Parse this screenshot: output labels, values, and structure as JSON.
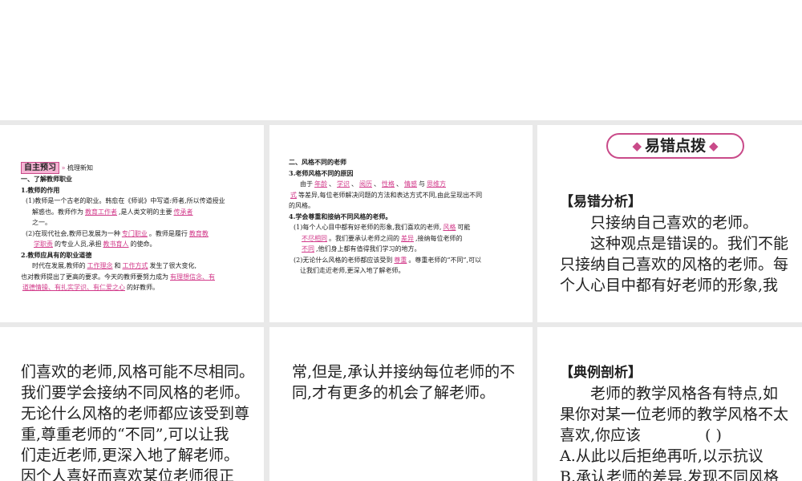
{
  "p1": {
    "header_box": "自主预习",
    "header_arrow": "»",
    "header_sub": "梳理新知",
    "s1_title": "一、了解教师职业",
    "q1": "1.教师的作用",
    "q1_1a": "(1)教师是一个古老的职业。韩愈在《师说》中写道:师者,所以传道授业",
    "q1_1b_pre": "解惑也。教师作为",
    "q1_1b_ans1": "教育工作者",
    "q1_1b_mid": ",是人类文明的主要",
    "q1_1b_ans2": "传承者",
    "q1_1c": "之一。",
    "q1_2a_pre": "(2)在现代社会,教师已发展为一种",
    "q1_2a_ans1": "专门职业",
    "q1_2a_mid": "。教师是履行",
    "q1_2a_ans2": "教育教",
    "q1_2b_ans2b": "学职责",
    "q1_2b_mid": "的专业人员,承担",
    "q1_2b_ans3": "教书育人",
    "q1_2b_post": "的使命。",
    "q2": "2.教师应具有的职业道德",
    "q2a_pre": "时代在发展,教师的",
    "q2a_ans1": "工作理念",
    "q2a_mid": "和",
    "q2a_ans2": "工作方式",
    "q2a_post": "发生了很大变化,",
    "q2b_pre": "也对教师提出了更高的要求。今天的教师要努力成为",
    "q2b_ans": "有理想信念、有",
    "q2c_ans": "道德情操、有扎实学识、有仁爱之心",
    "q2c_post": "的好教师。"
  },
  "p2": {
    "s2_title": "二、风格不同的老师",
    "q3": "3.老师风格不同的原因",
    "q3a_pre": "由于",
    "q3a_ans1": "年龄",
    "q3a_ans2": "学识",
    "q3a_ans3": "阅历",
    "q3a_ans4": "性格",
    "q3a_ans5": "情感",
    "q3a_and": "与",
    "q3a_ans6": "思维方",
    "q3b_ans6b": "式",
    "q3b_post": "等差异,每位老师解决问题的方法和表达方式不同,由此呈现出不同",
    "q3c": "的风格。",
    "q4": "4.学会尊重和接纳不同风格的老师。",
    "q4_1a_pre": "(1)每个人心目中都有好老师的形象,我们喜欢的老师,",
    "q4_1a_ans": "风格",
    "q4_1a_post": "可能",
    "q4_1b_ans": "不尽相同",
    "q4_1b_mid": "。我们要承认老师之间的",
    "q4_1b_ans2": "差异",
    "q4_1b_post": ",接纳每位老师的",
    "q4_1c_ans": "不同",
    "q4_1c_post": ",他们身上都有值得我们学习的地方。",
    "q4_2a_pre": "(2)无论什么风格的老师都应该受到",
    "q4_2a_ans": "尊重",
    "q4_2a_post": "。尊重老师的“不同”,可以",
    "q4_2b": "让我们走近老师,更深入地了解老师。"
  },
  "p3": {
    "banner_left": "◆",
    "banner": "易错点拨",
    "banner_right": "◆",
    "label": "【易错分析】",
    "l1": "只接纳自己喜欢的老师。",
    "l2": "这种观点是错误的。我们不能",
    "l3": "只接纳自己喜欢的风格的老师。每",
    "l4": "个人心目中都有好老师的形象,我"
  },
  "p4": {
    "l1": "们喜欢的老师,风格可能不尽相同。",
    "l2": "我们要学会接纳不同风格的老师。",
    "l3": "无论什么风格的老师都应该受到尊",
    "l4": "重,尊重老师的“不同”,可以让我",
    "l5": "们走近老师,更深入地了解老师。",
    "l6": "因个人喜好而喜欢某位老师很正"
  },
  "p5": {
    "l1": "常,但是,承认并接纳每位老师的不",
    "l2": "同,才有更多的机会了解老师。"
  },
  "p6": {
    "label": "【典例剖析】",
    "l1": "老师的教学风格各有特点,如",
    "l2": "果你对某一位老师的教学风格不太",
    "l3": "喜欢,你应该",
    "l3_paren": "(  )",
    "l4": "A.从此以后拒绝再听,以示抗议",
    "l5": "B.承认老师的差异,发现不同风格"
  }
}
